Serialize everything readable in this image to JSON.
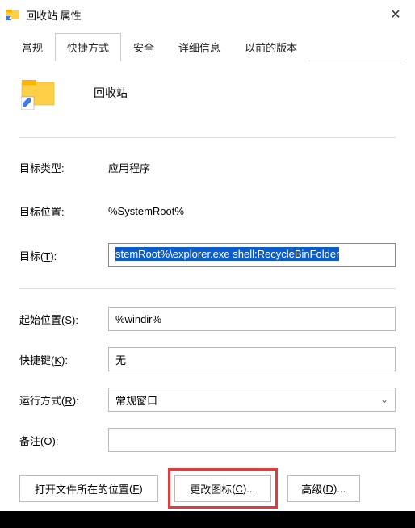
{
  "window": {
    "title": "回收站 属性"
  },
  "tabs": {
    "general": "常规",
    "shortcut": "快捷方式",
    "security": "安全",
    "details": "详细信息",
    "previous": "以前的版本"
  },
  "shortcut_panel": {
    "name": "回收站",
    "labels": {
      "target_type": "目标类型:",
      "target_location": "目标位置:",
      "target": "目标",
      "target_key": "T",
      "start_in": "起始位置",
      "start_in_key": "S",
      "hotkey": "快捷键",
      "hotkey_key": "K",
      "run": "运行方式",
      "run_key": "R",
      "comment": "备注",
      "comment_key": "O"
    },
    "values": {
      "target_type": "应用程序",
      "target_location": "%SystemRoot%",
      "target": "stemRoot%\\explorer.exe shell:RecycleBinFolder",
      "start_in": "%windir%",
      "hotkey": "无",
      "run": "常规窗口",
      "comment": ""
    },
    "buttons": {
      "open_file_location": "打开文件所在的位置",
      "open_file_location_key": "F",
      "change_icon": "更改图标",
      "change_icon_key": "C",
      "advanced": "高级",
      "advanced_key": "D"
    }
  }
}
